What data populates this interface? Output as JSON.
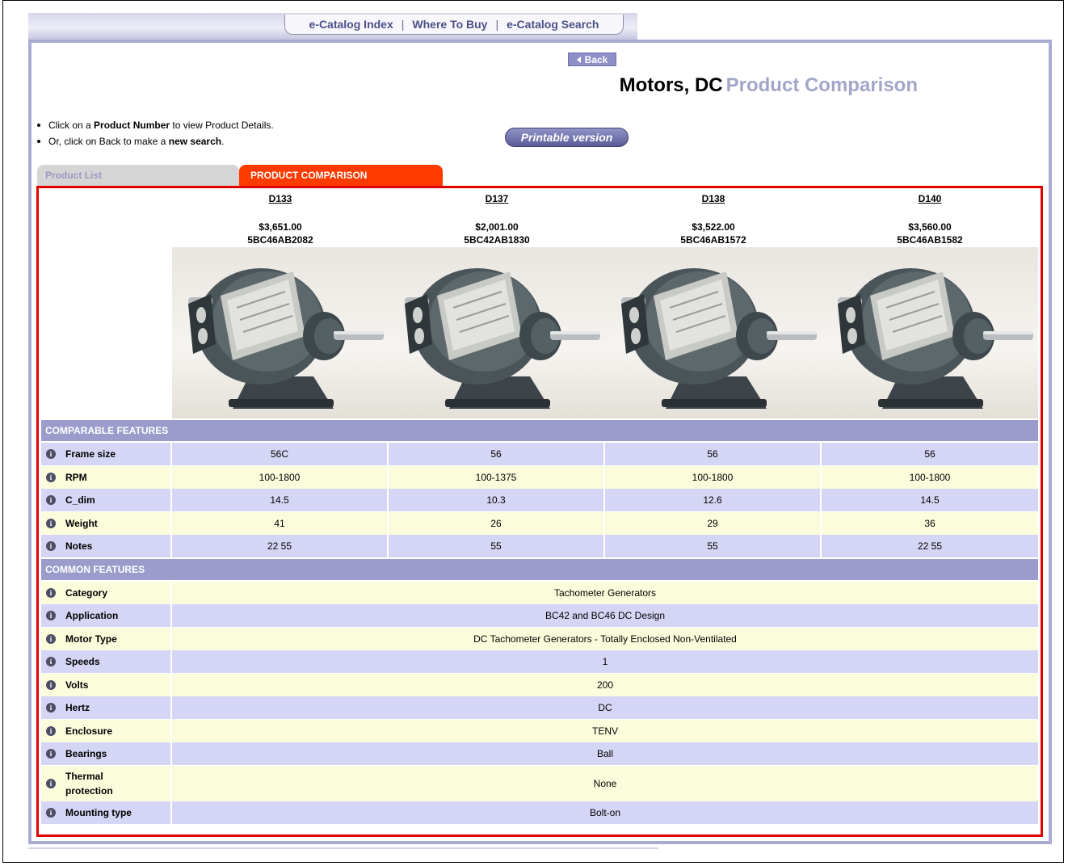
{
  "nav": {
    "links": [
      "e-Catalog Index",
      "Where To Buy",
      "e-Catalog Search"
    ],
    "separator": "|"
  },
  "back_label": "Back",
  "title": {
    "main": "Motors, DC",
    "sub": "Product Comparison"
  },
  "instructions": {
    "line1_pre": "Click on a ",
    "line1_bold": "Product Number",
    "line1_post": " to view Product Details.",
    "line2_pre": "Or, click on Back to make a ",
    "line2_bold": "new search",
    "line2_post": "."
  },
  "printable_label": "Printable version",
  "tabs": {
    "product_list": "Product List",
    "product_comparison": "PRODUCT COMPARISON"
  },
  "products": [
    {
      "number": "D133",
      "price": "$3,651.00",
      "sku": "5BC46AB2082"
    },
    {
      "number": "D137",
      "price": "$2,001.00",
      "sku": "5BC42AB1830"
    },
    {
      "number": "D138",
      "price": "$3,522.00",
      "sku": "5BC46AB1572"
    },
    {
      "number": "D140",
      "price": "$3,560.00",
      "sku": "5BC46AB1582"
    }
  ],
  "comparable": {
    "header": "COMPARABLE FEATURES",
    "rows": [
      {
        "label": "Frame size",
        "values": [
          "56C",
          "56",
          "56",
          "56"
        ]
      },
      {
        "label": "RPM",
        "values": [
          "100-1800",
          "100-1375",
          "100-1800",
          "100-1800"
        ]
      },
      {
        "label": "C_dim",
        "values": [
          "14.5",
          "10.3",
          "12.6",
          "14.5"
        ]
      },
      {
        "label": "Weight",
        "values": [
          "41",
          "26",
          "29",
          "36"
        ]
      },
      {
        "label": "Notes",
        "values": [
          "22 55",
          "55",
          "55",
          "22 55"
        ]
      }
    ]
  },
  "common": {
    "header": "COMMON FEATURES",
    "rows": [
      {
        "label": "Category",
        "value": "Tachometer Generators"
      },
      {
        "label": "Application",
        "value": "BC42 and BC46 DC Design"
      },
      {
        "label": "Motor Type",
        "value": "DC Tachometer Generators - Totally Enclosed Non-Ventilated"
      },
      {
        "label": "Speeds",
        "value": "1"
      },
      {
        "label": "Volts",
        "value": "200"
      },
      {
        "label": "Hertz",
        "value": "DC"
      },
      {
        "label": "Enclosure",
        "value": "TENV"
      },
      {
        "label": "Bearings",
        "value": "Ball"
      },
      {
        "label": "Thermal protection",
        "value": "None"
      },
      {
        "label": "Mounting type",
        "value": "Bolt-on"
      }
    ]
  },
  "colors": {
    "accent_tab": "#ff3b00",
    "frame_red": "#e00000",
    "section_header": "#9b9ccb",
    "row_purple": "#d5d6f5",
    "row_cream": "#fbfcdc"
  }
}
